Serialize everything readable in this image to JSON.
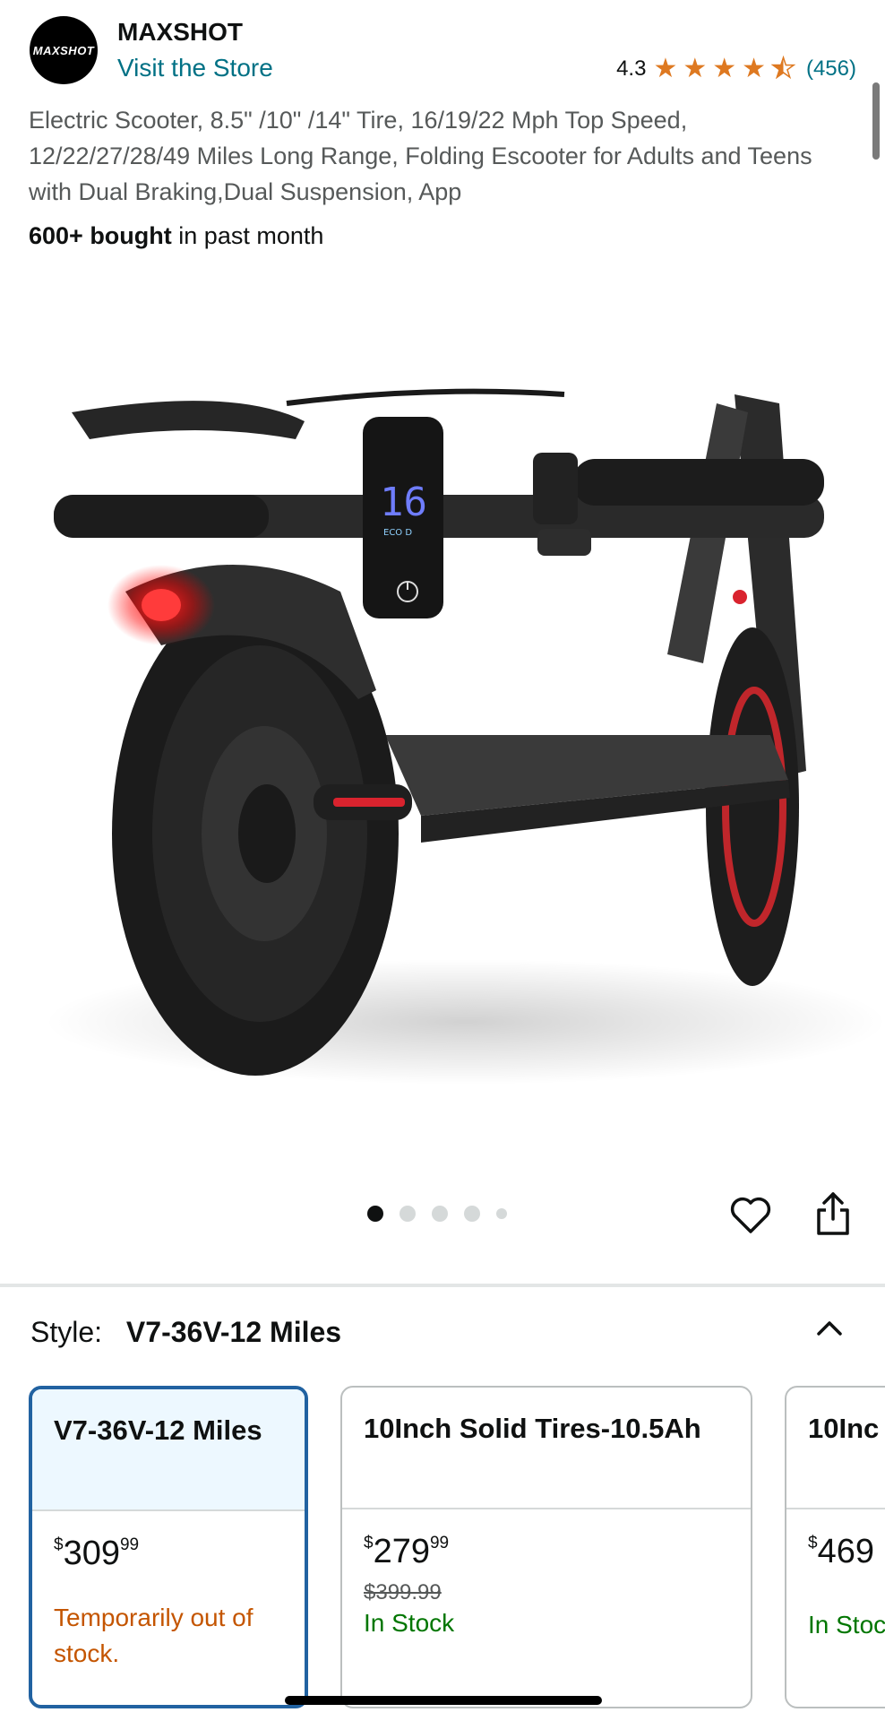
{
  "header": {
    "brand_logo_text": "MAXSHOT",
    "brand_name": "MAXSHOT",
    "store_link": "Visit the Store",
    "rating_value": "4.3",
    "rating_count": "(456)",
    "rating_stars": 4.3
  },
  "product": {
    "title": "Electric Scooter, 8.5\" /10\" /14\" Tire, 16/19/22 Mph Top Speed, 12/22/27/28/49 Miles Long Range, Folding Escooter for Adults and Teens with Dual Braking,Dual Suspension, App",
    "bought_bold": "600+ bought",
    "bought_rest": " in past month",
    "display_speed": "16",
    "display_mode": "ECO D"
  },
  "carousel": {
    "dot_count": 5,
    "active_index": 0
  },
  "style": {
    "label": "Style:",
    "selected_value": "V7-36V-12 Miles"
  },
  "options": [
    {
      "name": "V7-36V-12 Miles",
      "price_symbol": "$",
      "price_whole": "309",
      "price_fraction": "99",
      "list_price": "",
      "availability": "Temporarily out of stock."
    },
    {
      "name": "10Inch Solid Tires-10.5Ah",
      "price_symbol": "$",
      "price_whole": "279",
      "price_fraction": "99",
      "list_price": "$399.99",
      "availability": "In Stock"
    },
    {
      "name": "10Inc",
      "price_symbol": "$",
      "price_whole": "469",
      "price_fraction": "",
      "list_price": "",
      "availability": "In Stoc"
    }
  ],
  "colors": {
    "link": "#007185",
    "star": "#de7921",
    "in_stock": "#007600",
    "out_of_stock": "#c45500",
    "selected_border": "#2162a1"
  }
}
